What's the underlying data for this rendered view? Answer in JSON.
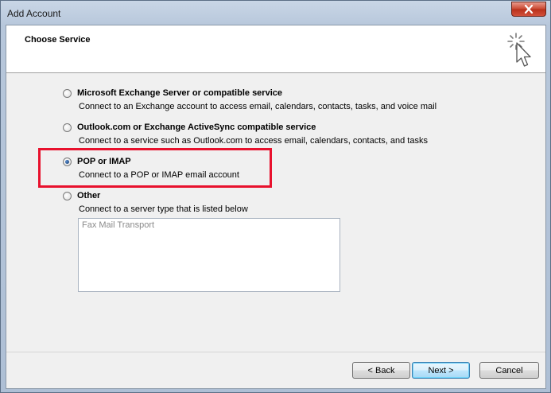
{
  "window": {
    "title": "Add Account"
  },
  "page": {
    "title": "Choose Service"
  },
  "options": [
    {
      "label": "Microsoft Exchange Server or compatible service",
      "description": "Connect to an Exchange account to access email, calendars, contacts, tasks, and voice mail",
      "selected": false
    },
    {
      "label": "Outlook.com or Exchange ActiveSync compatible service",
      "description": "Connect to a service such as Outlook.com to access email, calendars, contacts, and tasks",
      "selected": false
    },
    {
      "label": "POP or IMAP",
      "description": "Connect to a POP or IMAP email account",
      "selected": true
    },
    {
      "label": "Other",
      "description": "Connect to a server type that is listed below",
      "selected": false
    }
  ],
  "server_types": [
    "Fax Mail Transport"
  ],
  "buttons": {
    "back": "< Back",
    "next": "Next >",
    "cancel": "Cancel"
  },
  "colors": {
    "highlight": "#e8112d",
    "close_button": "#c8462f",
    "default_button": "#3c7fb1"
  },
  "icons": {
    "header": "wizard-sparkle-cursor-icon",
    "close": "close-icon"
  }
}
